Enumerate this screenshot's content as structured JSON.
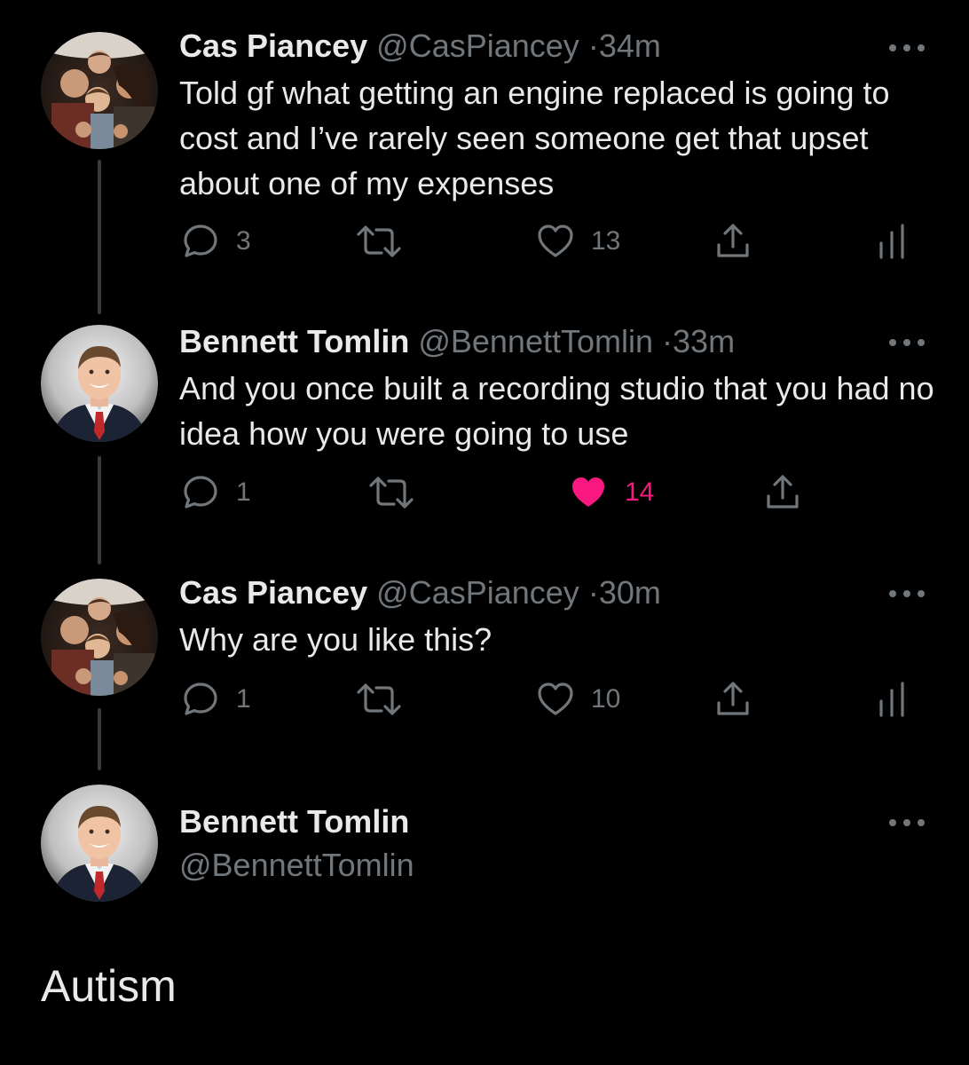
{
  "tweets": [
    {
      "name": "Cas Piancey",
      "handle": "@CasPiancey",
      "separator": "·",
      "time": "34m",
      "text": "Told gf what getting an engine replaced is going to cost and I’ve rarely seen someone get that upset about one of my expenses",
      "replies": "3",
      "likes": "13",
      "liked": false
    },
    {
      "name": "Bennett Tomlin",
      "handle": "@BennettTomlin",
      "separator": "·",
      "time": "33m",
      "text": "And you once built a recording studio that you had no idea how you were going to use",
      "replies": "1",
      "likes": "14",
      "liked": true
    },
    {
      "name": "Cas Piancey",
      "handle": "@CasPiancey",
      "separator": "·",
      "time": "30m",
      "text": "Why are you like this?",
      "replies": "1",
      "likes": "10",
      "liked": false
    }
  ],
  "final_tweet": {
    "name": "Bennett Tomlin",
    "handle": "@BennettTomlin"
  },
  "caption": "Autism",
  "colors": {
    "background": "#000000",
    "text_primary": "#e7e9ea",
    "text_secondary": "#71767b",
    "like_active": "#f91880",
    "thread_line": "#3a3a3a"
  },
  "icons": [
    "more-icon",
    "reply-icon",
    "retweet-icon",
    "like-icon",
    "share-icon",
    "analytics-icon"
  ]
}
